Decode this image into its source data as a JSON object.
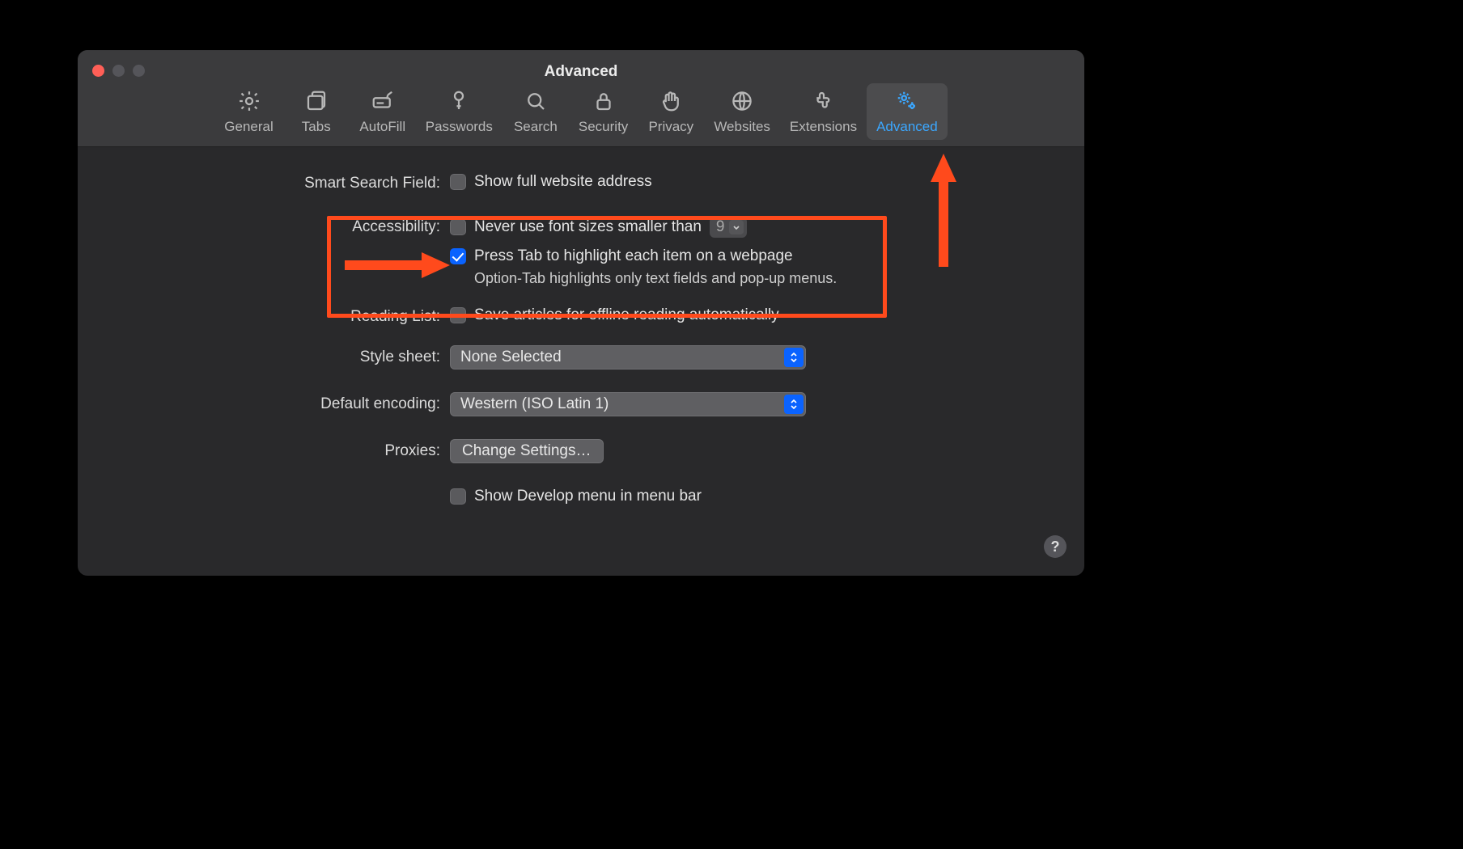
{
  "window": {
    "title": "Advanced"
  },
  "toolbar": {
    "items": [
      {
        "label": "General"
      },
      {
        "label": "Tabs"
      },
      {
        "label": "AutoFill"
      },
      {
        "label": "Passwords"
      },
      {
        "label": "Search"
      },
      {
        "label": "Security"
      },
      {
        "label": "Privacy"
      },
      {
        "label": "Websites"
      },
      {
        "label": "Extensions"
      },
      {
        "label": "Advanced"
      }
    ],
    "active_index": 9
  },
  "sections": {
    "smart_search": {
      "label": "Smart Search Field:",
      "show_full_url_label": "Show full website address",
      "show_full_url_checked": false
    },
    "accessibility": {
      "label": "Accessibility:",
      "never_smaller_label": "Never use font sizes smaller than",
      "never_smaller_checked": false,
      "font_size_value": "9",
      "press_tab_label": "Press Tab to highlight each item on a webpage",
      "press_tab_checked": true,
      "helper": "Option-Tab highlights only text fields and pop-up menus."
    },
    "reading_list": {
      "label": "Reading List:",
      "save_offline_label": "Save articles for offline reading automatically",
      "save_offline_checked": false
    },
    "style_sheet": {
      "label": "Style sheet:",
      "value": "None Selected"
    },
    "encoding": {
      "label": "Default encoding:",
      "value": "Western (ISO Latin 1)"
    },
    "proxies": {
      "label": "Proxies:",
      "button_label": "Change Settings…"
    },
    "develop": {
      "label": "Show Develop menu in menu bar",
      "checked": false
    }
  },
  "help_button": "?",
  "annotations": {
    "color": "#ff4a1c"
  }
}
